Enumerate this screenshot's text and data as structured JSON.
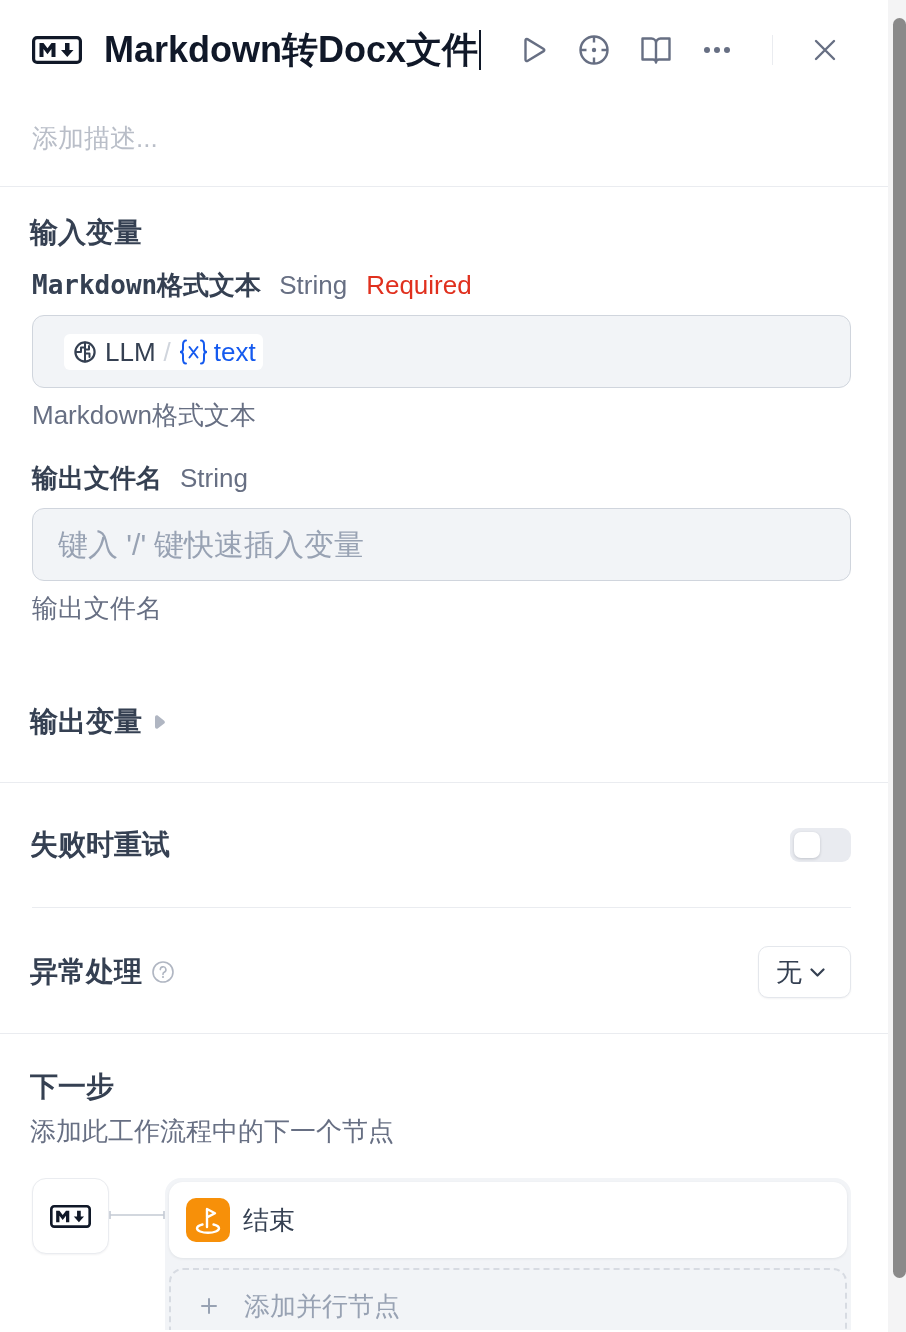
{
  "header": {
    "title": "Markdown转Docx文件",
    "description": {
      "placeholder": "添加描述..."
    }
  },
  "input_variables": {
    "title": "输入变量",
    "fields": [
      {
        "kind": "variable",
        "label": "Markdown格式文本",
        "type": "String",
        "required_label": "Required",
        "value": {
          "node": "LLM",
          "separator": "/",
          "variable": "text"
        },
        "description": "Markdown格式文本"
      },
      {
        "kind": "text",
        "label": "输出文件名",
        "type": "String",
        "placeholder": "键入 '/' 键快速插入变量",
        "description": "输出文件名"
      }
    ]
  },
  "output_variables": {
    "title": "输出变量",
    "expanded": false
  },
  "retry_on_failure": {
    "title": "失败时重试",
    "on": false
  },
  "error_handling": {
    "title": "异常处理",
    "value": "无"
  },
  "next_step": {
    "title": "下一步",
    "subtitle": "添加此工作流程中的下一个节点",
    "nodes": [
      {
        "label": "结束"
      }
    ],
    "add_parallel": "添加并行节点"
  }
}
